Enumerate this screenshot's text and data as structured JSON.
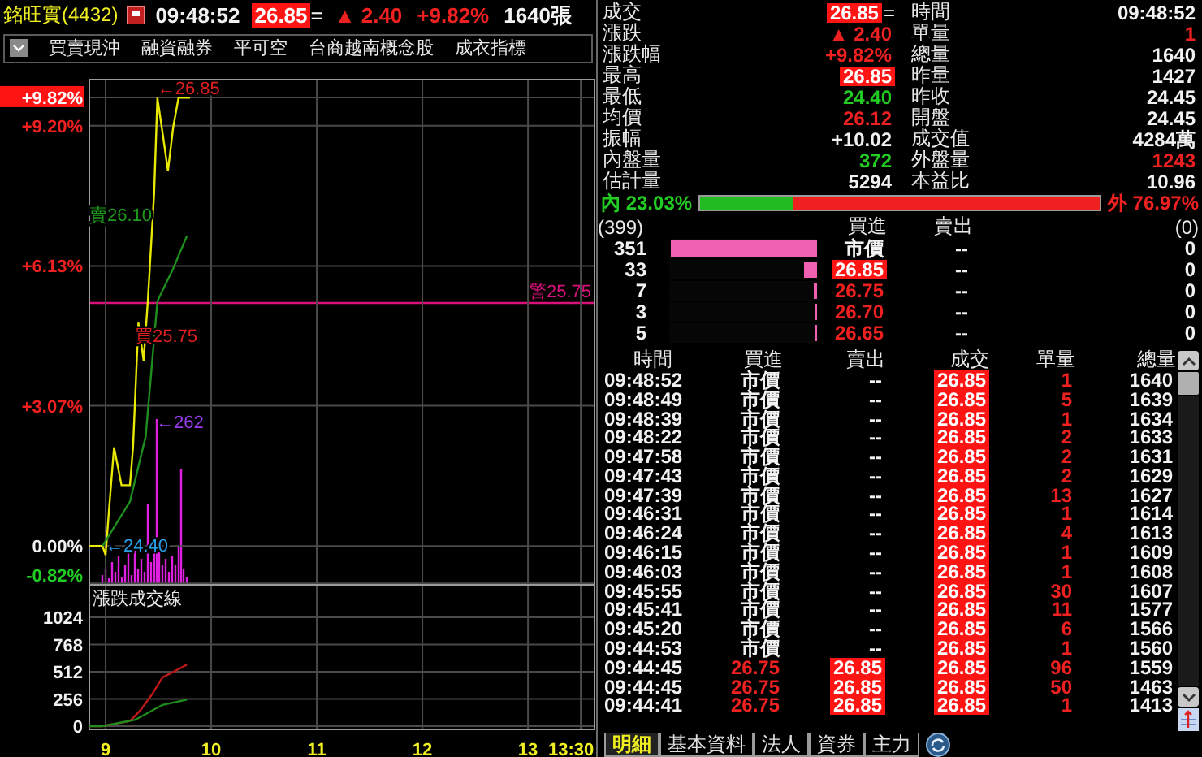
{
  "header": {
    "name": "銘旺實(4432)",
    "time": "09:48:52",
    "price": {
      "text": "26.85",
      "kind": "limit"
    },
    "flat_mark": "=",
    "change": {
      "text": "▲ 2.40",
      "kind": "up"
    },
    "change_pct": {
      "text": "+9.82%",
      "kind": "up"
    },
    "volume": "1640張"
  },
  "tags": [
    "買賣現沖",
    "融資融券",
    "平可空",
    "台商越南概念股",
    "成衣指標"
  ],
  "price_chart": {
    "alert_label": "警25.75",
    "chart_data": {
      "type": "line",
      "grid": true,
      "xlim": [
        8.846,
        13.63
      ],
      "ylim": [
        -0.85,
        10.21
      ],
      "yticks": [
        {
          "value": 9.82,
          "label": "+9.82%"
        },
        {
          "value": 9.2,
          "label": "+9.20%"
        },
        {
          "value": 6.13,
          "label": "+6.13%"
        },
        {
          "value": 3.07,
          "label": "+3.07%"
        },
        {
          "value": 0,
          "label": "0.00%"
        },
        {
          "value": -0.82,
          "label": "-0.82%"
        }
      ],
      "series": [
        {
          "color": "#e8e800",
          "x": [
            8.846,
            8.97,
            9.0,
            9.03,
            9.08,
            9.15,
            9.23,
            9.26,
            9.31,
            9.36,
            9.4,
            9.46,
            9.49,
            9.54,
            9.59,
            9.64,
            9.69,
            9.8
          ],
          "values": [
            0,
            0,
            -0.2,
            0.74,
            2.16,
            1.33,
            1.33,
            2.16,
            4.89,
            4.06,
            5.36,
            7.73,
            9.81,
            9.04,
            8.21,
            9.16,
            9.81,
            9.81
          ]
        },
        {
          "color": "#1e8e1e",
          "x": [
            8.97,
            9.23,
            9.38,
            9.49,
            9.64,
            9.77
          ],
          "values": [
            0,
            0.97,
            2.4,
            5.36,
            6.07,
            6.79
          ]
        }
      ],
      "annotations": [
        {
          "text": "←26.85",
          "x": 9.49,
          "y": 9.81
        },
        "賣26.10",
        "買25.75",
        {
          "text": "←24.40",
          "x": 9.0,
          "y": -0.2
        },
        "←262"
      ]
    }
  },
  "volume_chart": {
    "chart_data": {
      "type": "line",
      "grid": true,
      "title": "漲跌成交線",
      "xlim": [
        8.846,
        13.63
      ],
      "ylim": [
        -30,
        1330
      ],
      "yticks": [
        0,
        256,
        512,
        768,
        1024
      ],
      "xticks": [
        {
          "value": 9,
          "label": "9"
        },
        {
          "value": 10,
          "label": "10"
        },
        {
          "value": 11,
          "label": "11"
        },
        {
          "value": 12,
          "label": "12"
        },
        {
          "value": 13,
          "label": "13"
        },
        {
          "value": 13.5,
          "label": "13:30"
        }
      ],
      "series": [
        {
          "color": "#c01818",
          "x": [
            8.846,
            8.97,
            9.23,
            9.33,
            9.44,
            9.54,
            9.64,
            9.77
          ],
          "values": [
            0,
            0,
            50,
            150,
            300,
            460,
            510,
            580
          ]
        },
        {
          "color": "#1e8e1e",
          "x": [
            8.846,
            8.97,
            9.28,
            9.54,
            9.77
          ],
          "values": [
            0,
            0,
            60,
            200,
            250
          ]
        }
      ]
    }
  },
  "quote": [
    {
      "left": {
        "label": "成交",
        "text": "26.85",
        "kind": "limit",
        "suffix": "="
      },
      "right": {
        "label": "時間",
        "text": "09:48:52",
        "kind": "plain"
      }
    },
    {
      "left": {
        "label": "漲跌",
        "text": "▲ 2.40",
        "kind": "up"
      },
      "right": {
        "label": "單量",
        "text": "1",
        "kind": "up"
      }
    },
    {
      "left": {
        "label": "漲跌幅",
        "text": "+9.82%",
        "kind": "up"
      },
      "right": {
        "label": "總量",
        "text": "1640",
        "kind": "plain"
      }
    },
    {
      "left": {
        "label": "最高",
        "text": "26.85",
        "kind": "limit"
      },
      "right": {
        "label": "昨量",
        "text": "1427",
        "kind": "plain"
      }
    },
    {
      "left": {
        "label": "最低",
        "text": "24.40",
        "kind": "down"
      },
      "right": {
        "label": "昨收",
        "text": "24.45",
        "kind": "plain"
      }
    },
    {
      "left": {
        "label": "均價",
        "text": "26.12",
        "kind": "up"
      },
      "right": {
        "label": "開盤",
        "text": "24.45",
        "kind": "plain"
      }
    },
    {
      "left": {
        "label": "振幅",
        "text": "+10.02",
        "kind": "plain"
      },
      "right": {
        "label": "成交值",
        "text": "4284萬",
        "kind": "plain"
      }
    },
    {
      "left": {
        "label": "內盤量",
        "text": "372",
        "kind": "down"
      },
      "right": {
        "label": "外盤量",
        "text": "1243",
        "kind": "up"
      }
    },
    {
      "left": {
        "label": "估計量",
        "text": "5294",
        "kind": "plain"
      },
      "right": {
        "label": "本益比",
        "text": "10.96",
        "kind": "plain"
      }
    }
  ],
  "ratio": {
    "inner": "內 23.03%",
    "level": 0.2303,
    "outer": "外 76.97%"
  },
  "order_book": {
    "total_bid": "(399)",
    "bid_header": "買進",
    "ask_header": "賣出",
    "total_ask": "(0)",
    "rows": [
      {
        "bid_qty": "351",
        "level": 1,
        "bid": {
          "text": "市價",
          "kind": "plain"
        },
        "ask": "--",
        "ask_qty": "0"
      },
      {
        "bid_qty": "33",
        "level": 0.094,
        "bid": {
          "text": "26.85",
          "kind": "limit"
        },
        "ask": "--",
        "ask_qty": "0"
      },
      {
        "bid_qty": "7",
        "level": 0.02,
        "bid": {
          "text": "26.75",
          "kind": "up"
        },
        "ask": "--",
        "ask_qty": "0"
      },
      {
        "bid_qty": "3",
        "level": 0.0085,
        "bid": {
          "text": "26.70",
          "kind": "up"
        },
        "ask": "--",
        "ask_qty": "0"
      },
      {
        "bid_qty": "5",
        "level": 0.014,
        "bid": {
          "text": "26.65",
          "kind": "up"
        },
        "ask": "--",
        "ask_qty": "0"
      }
    ]
  },
  "ticks": {
    "columns": [
      "時間",
      "買進",
      "賣出",
      "成交",
      "單量",
      "總量"
    ],
    "rows": [
      {
        "time": "09:48:52",
        "bid": {
          "text": "市價",
          "kind": "plain"
        },
        "ask": {
          "text": "--",
          "kind": "plain"
        },
        "price": {
          "text": "26.85",
          "kind": "limit"
        },
        "volume": {
          "text": "1",
          "kind": "up"
        },
        "total": "1640"
      },
      {
        "time": "09:48:49",
        "bid": {
          "text": "市價",
          "kind": "plain"
        },
        "ask": {
          "text": "--",
          "kind": "plain"
        },
        "price": {
          "text": "26.85",
          "kind": "limit"
        },
        "volume": {
          "text": "5",
          "kind": "up"
        },
        "total": "1639"
      },
      {
        "time": "09:48:39",
        "bid": {
          "text": "市價",
          "kind": "plain"
        },
        "ask": {
          "text": "--",
          "kind": "plain"
        },
        "price": {
          "text": "26.85",
          "kind": "limit"
        },
        "volume": {
          "text": "1",
          "kind": "up"
        },
        "total": "1634"
      },
      {
        "time": "09:48:22",
        "bid": {
          "text": "市價",
          "kind": "plain"
        },
        "ask": {
          "text": "--",
          "kind": "plain"
        },
        "price": {
          "text": "26.85",
          "kind": "limit"
        },
        "volume": {
          "text": "2",
          "kind": "up"
        },
        "total": "1633"
      },
      {
        "time": "09:47:58",
        "bid": {
          "text": "市價",
          "kind": "plain"
        },
        "ask": {
          "text": "--",
          "kind": "plain"
        },
        "price": {
          "text": "26.85",
          "kind": "limit"
        },
        "volume": {
          "text": "2",
          "kind": "up"
        },
        "total": "1631"
      },
      {
        "time": "09:47:43",
        "bid": {
          "text": "市價",
          "kind": "plain"
        },
        "ask": {
          "text": "--",
          "kind": "plain"
        },
        "price": {
          "text": "26.85",
          "kind": "limit"
        },
        "volume": {
          "text": "2",
          "kind": "up"
        },
        "total": "1629"
      },
      {
        "time": "09:47:39",
        "bid": {
          "text": "市價",
          "kind": "plain"
        },
        "ask": {
          "text": "--",
          "kind": "plain"
        },
        "price": {
          "text": "26.85",
          "kind": "limit"
        },
        "volume": {
          "text": "13",
          "kind": "up"
        },
        "total": "1627"
      },
      {
        "time": "09:46:31",
        "bid": {
          "text": "市價",
          "kind": "plain"
        },
        "ask": {
          "text": "--",
          "kind": "plain"
        },
        "price": {
          "text": "26.85",
          "kind": "limit"
        },
        "volume": {
          "text": "1",
          "kind": "up"
        },
        "total": "1614"
      },
      {
        "time": "09:46:24",
        "bid": {
          "text": "市價",
          "kind": "plain"
        },
        "ask": {
          "text": "--",
          "kind": "plain"
        },
        "price": {
          "text": "26.85",
          "kind": "limit"
        },
        "volume": {
          "text": "4",
          "kind": "up"
        },
        "total": "1613"
      },
      {
        "time": "09:46:15",
        "bid": {
          "text": "市價",
          "kind": "plain"
        },
        "ask": {
          "text": "--",
          "kind": "plain"
        },
        "price": {
          "text": "26.85",
          "kind": "limit"
        },
        "volume": {
          "text": "1",
          "kind": "up"
        },
        "total": "1609"
      },
      {
        "time": "09:46:03",
        "bid": {
          "text": "市價",
          "kind": "plain"
        },
        "ask": {
          "text": "--",
          "kind": "plain"
        },
        "price": {
          "text": "26.85",
          "kind": "limit"
        },
        "volume": {
          "text": "1",
          "kind": "up"
        },
        "total": "1608"
      },
      {
        "time": "09:45:55",
        "bid": {
          "text": "市價",
          "kind": "plain"
        },
        "ask": {
          "text": "--",
          "kind": "plain"
        },
        "price": {
          "text": "26.85",
          "kind": "limit"
        },
        "volume": {
          "text": "30",
          "kind": "up"
        },
        "total": "1607"
      },
      {
        "time": "09:45:41",
        "bid": {
          "text": "市價",
          "kind": "plain"
        },
        "ask": {
          "text": "--",
          "kind": "plain"
        },
        "price": {
          "text": "26.85",
          "kind": "limit"
        },
        "volume": {
          "text": "11",
          "kind": "up"
        },
        "total": "1577"
      },
      {
        "time": "09:45:20",
        "bid": {
          "text": "市價",
          "kind": "plain"
        },
        "ask": {
          "text": "--",
          "kind": "plain"
        },
        "price": {
          "text": "26.85",
          "kind": "limit"
        },
        "volume": {
          "text": "6",
          "kind": "up"
        },
        "total": "1566"
      },
      {
        "time": "09:44:53",
        "bid": {
          "text": "市價",
          "kind": "plain"
        },
        "ask": {
          "text": "--",
          "kind": "plain"
        },
        "price": {
          "text": "26.85",
          "kind": "limit"
        },
        "volume": {
          "text": "1",
          "kind": "up"
        },
        "total": "1560"
      },
      {
        "time": "09:44:45",
        "bid": {
          "text": "26.75",
          "kind": "up"
        },
        "ask": {
          "text": "26.85",
          "kind": "limit"
        },
        "price": {
          "text": "26.85",
          "kind": "limit"
        },
        "volume": {
          "text": "96",
          "kind": "up"
        },
        "total": "1559"
      },
      {
        "time": "09:44:45",
        "bid": {
          "text": "26.75",
          "kind": "up"
        },
        "ask": {
          "text": "26.85",
          "kind": "limit"
        },
        "price": {
          "text": "26.85",
          "kind": "limit"
        },
        "volume": {
          "text": "50",
          "kind": "up"
        },
        "total": "1463"
      },
      {
        "time": "09:44:41",
        "bid": {
          "text": "26.75",
          "kind": "up"
        },
        "ask": {
          "text": "26.85",
          "kind": "limit"
        },
        "price": {
          "text": "26.85",
          "kind": "limit"
        },
        "volume": {
          "text": "1",
          "kind": "up"
        },
        "total": "1413"
      }
    ]
  },
  "tabs": [
    {
      "label": "明細",
      "selected": true
    },
    {
      "label": "基本資料",
      "selected": false
    },
    {
      "label": "法人",
      "selected": false
    },
    {
      "label": "資券",
      "selected": false
    },
    {
      "label": "主力",
      "selected": false
    }
  ]
}
